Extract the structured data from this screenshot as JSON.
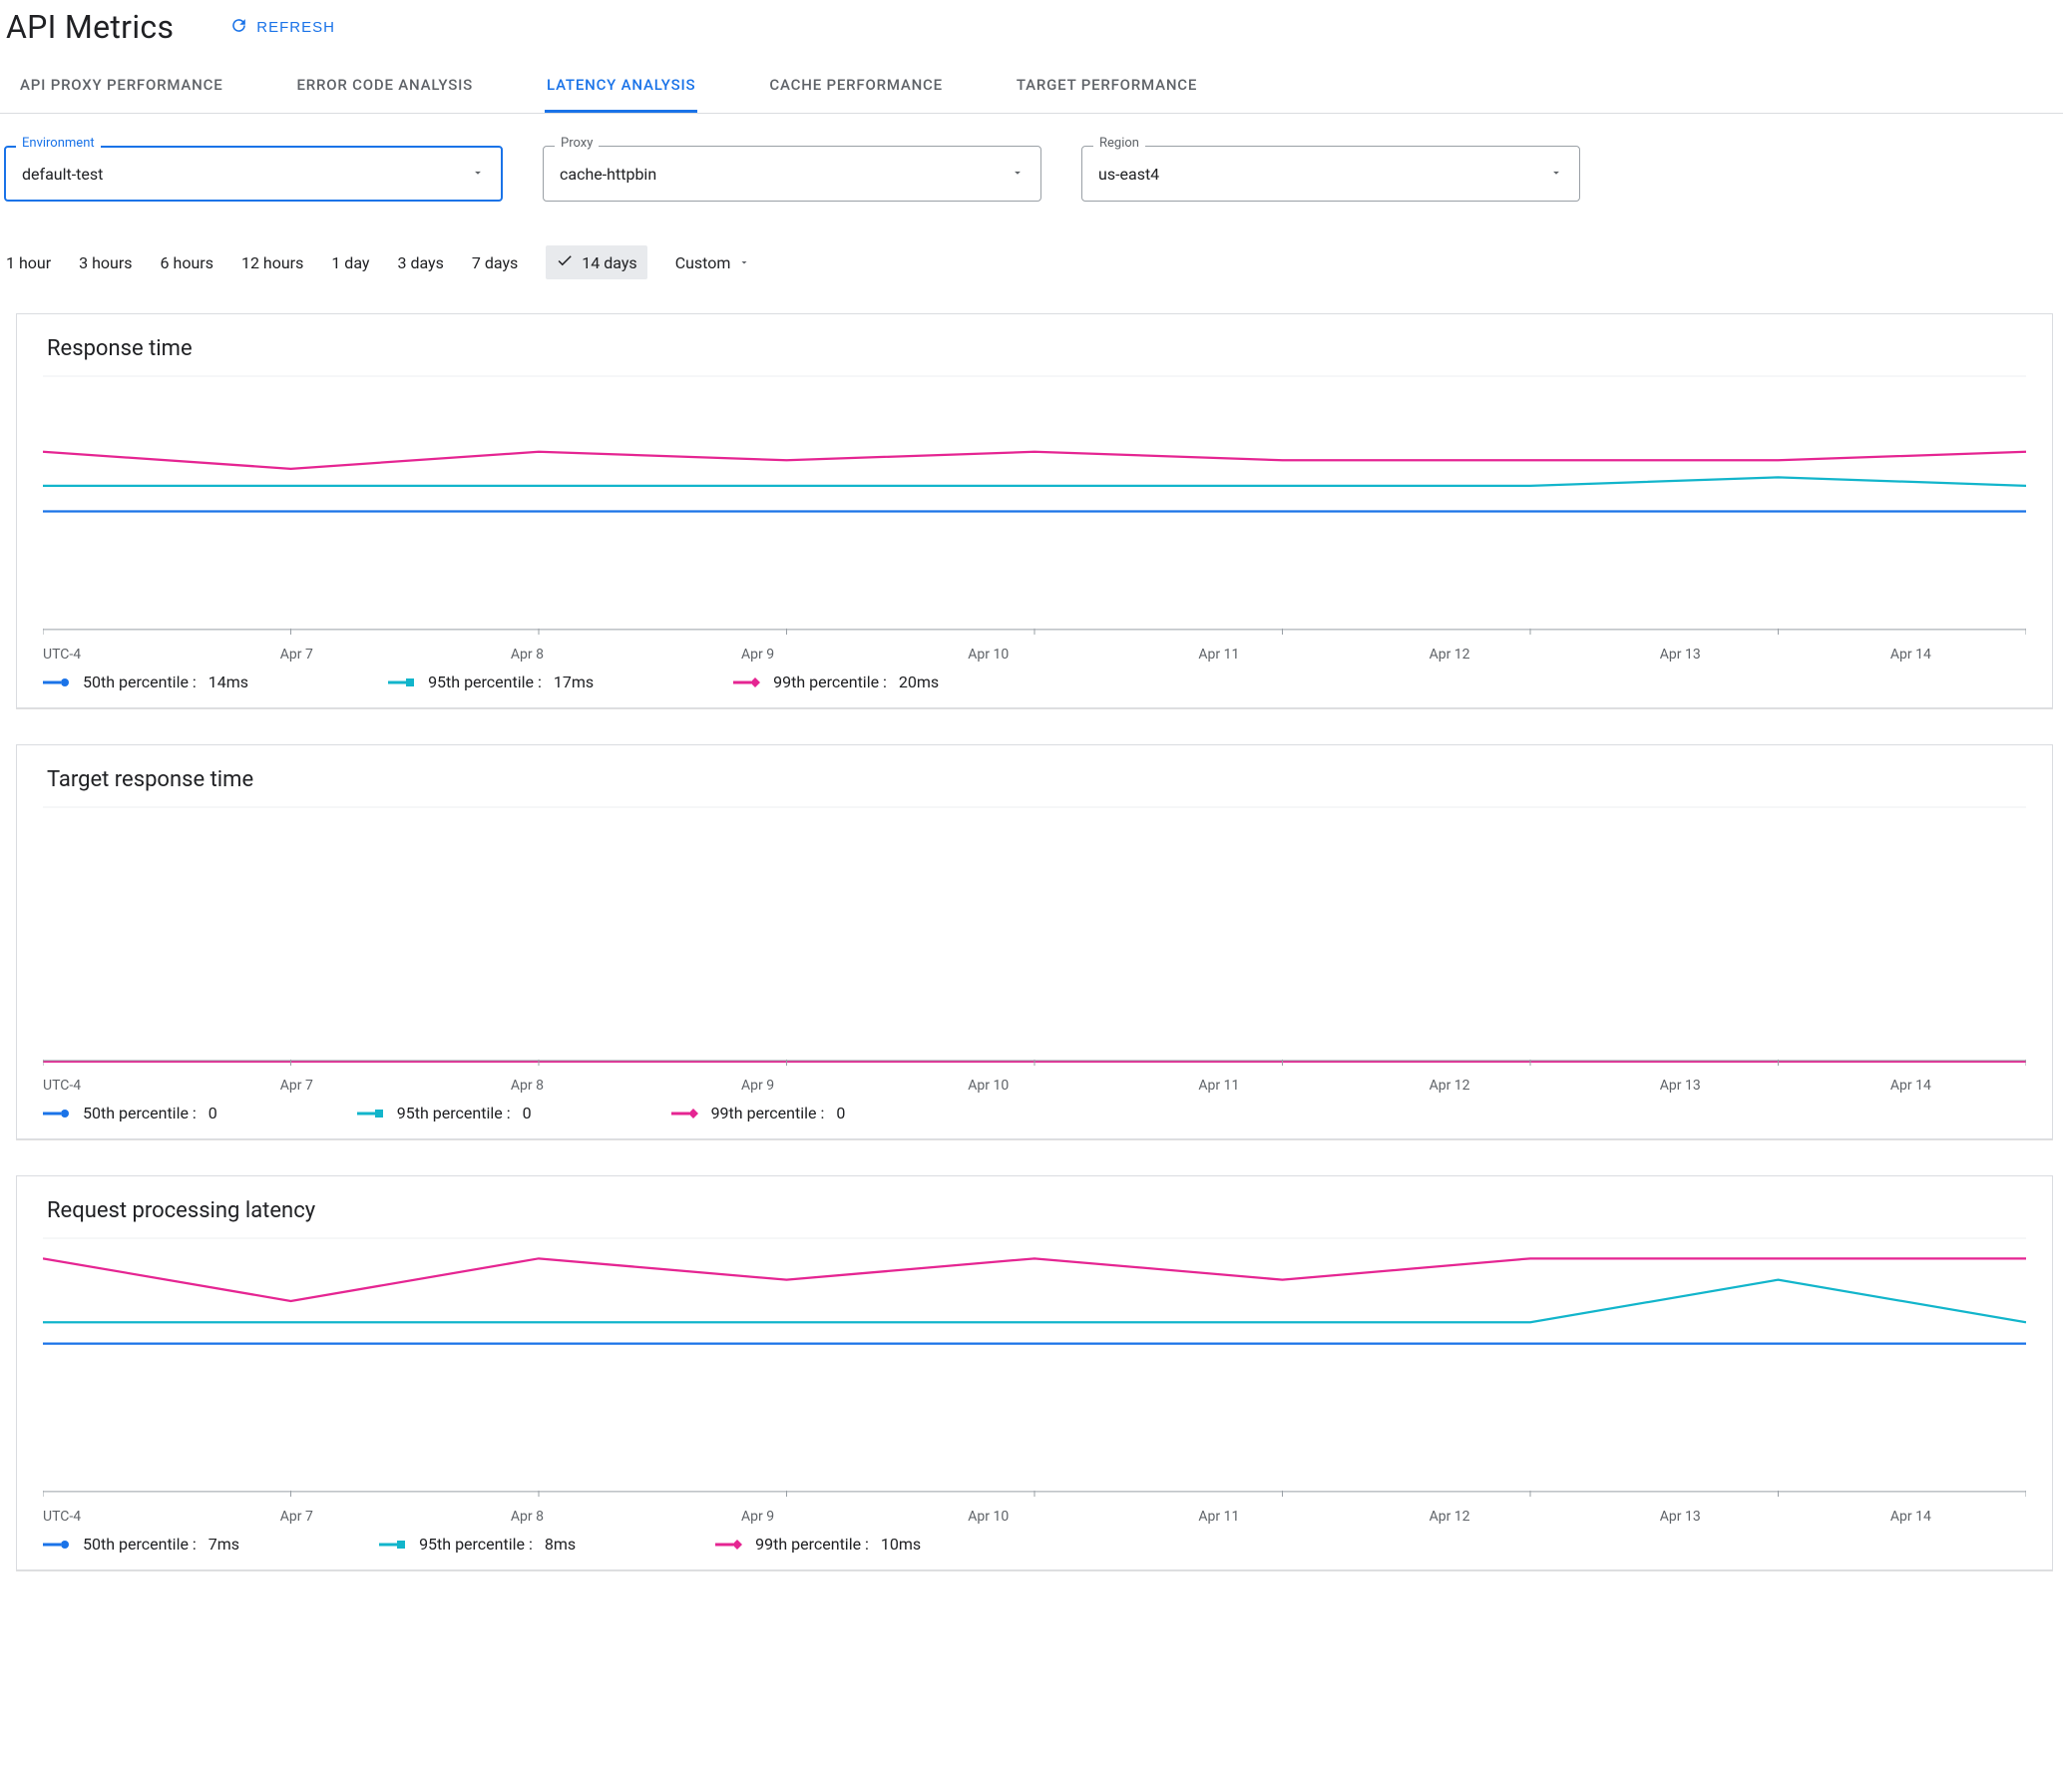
{
  "header": {
    "title": "API Metrics",
    "refresh": "REFRESH"
  },
  "tabs": [
    {
      "id": "api-proxy-performance",
      "label": "API PROXY PERFORMANCE",
      "active": false
    },
    {
      "id": "error-code-analysis",
      "label": "ERROR CODE ANALYSIS",
      "active": false
    },
    {
      "id": "latency-analysis",
      "label": "LATENCY ANALYSIS",
      "active": true
    },
    {
      "id": "cache-performance",
      "label": "CACHE PERFORMANCE",
      "active": false
    },
    {
      "id": "target-performance",
      "label": "TARGET PERFORMANCE",
      "active": false
    }
  ],
  "filters": {
    "environment": {
      "label": "Environment",
      "value": "default-test",
      "focused": true
    },
    "proxy": {
      "label": "Proxy",
      "value": "cache-httpbin",
      "focused": false
    },
    "region": {
      "label": "Region",
      "value": "us-east4",
      "focused": false
    }
  },
  "timerange": {
    "options": [
      "1 hour",
      "3 hours",
      "6 hours",
      "12 hours",
      "1 day",
      "3 days",
      "7 days",
      "14 days"
    ],
    "selected": "14 days",
    "custom_label": "Custom"
  },
  "x_ticks": [
    "UTC-4",
    "Apr 7",
    "Apr 8",
    "Apr 9",
    "Apr 10",
    "Apr 11",
    "Apr 12",
    "Apr 13",
    "Apr 14"
  ],
  "legend_series": [
    {
      "name": "50th percentile",
      "color": "#1a73e8",
      "marker": "circle"
    },
    {
      "name": "95th percentile",
      "color": "#12b5cb",
      "marker": "square"
    },
    {
      "name": "99th percentile",
      "color": "#e52592",
      "marker": "diamond"
    }
  ],
  "charts": [
    {
      "id": "response-time",
      "title": "Response time",
      "ylim": [
        0,
        30
      ],
      "legend_values": [
        "14ms",
        "17ms",
        "20ms"
      ]
    },
    {
      "id": "target-response-time",
      "title": "Target response time",
      "ylim": [
        0,
        30
      ],
      "legend_values": [
        "0",
        "0",
        "0"
      ]
    },
    {
      "id": "request-processing-latency",
      "title": "Request processing latency",
      "ylim": [
        0,
        12
      ],
      "legend_values": [
        "7ms",
        "8ms",
        "10ms"
      ]
    }
  ],
  "chart_data": [
    {
      "id": "response-time",
      "type": "line",
      "title": "Response time",
      "xlabel": "",
      "ylabel": "",
      "ylim": [
        0,
        30
      ],
      "categories": [
        "UTC-4",
        "Apr 7",
        "Apr 8",
        "Apr 9",
        "Apr 10",
        "Apr 11",
        "Apr 12",
        "Apr 13",
        "Apr 14"
      ],
      "series": [
        {
          "name": "50th percentile",
          "color": "#1a73e8",
          "values": [
            14,
            14,
            14,
            14,
            14,
            14,
            14,
            14,
            14
          ]
        },
        {
          "name": "95th percentile",
          "color": "#12b5cb",
          "values": [
            17,
            17,
            17,
            17,
            17,
            17,
            17,
            18,
            17
          ]
        },
        {
          "name": "99th percentile",
          "color": "#e52592",
          "values": [
            21,
            19,
            21,
            20,
            21,
            20,
            20,
            20,
            21
          ]
        }
      ]
    },
    {
      "id": "target-response-time",
      "type": "line",
      "title": "Target response time",
      "xlabel": "",
      "ylabel": "",
      "ylim": [
        0,
        30
      ],
      "categories": [
        "UTC-4",
        "Apr 7",
        "Apr 8",
        "Apr 9",
        "Apr 10",
        "Apr 11",
        "Apr 12",
        "Apr 13",
        "Apr 14"
      ],
      "series": [
        {
          "name": "50th percentile",
          "color": "#1a73e8",
          "values": [
            0,
            0,
            0,
            0,
            0,
            0,
            0,
            0,
            0
          ]
        },
        {
          "name": "95th percentile",
          "color": "#12b5cb",
          "values": [
            0,
            0,
            0,
            0,
            0,
            0,
            0,
            0,
            0
          ]
        },
        {
          "name": "99th percentile",
          "color": "#e52592",
          "values": [
            0,
            0,
            0,
            0,
            0,
            0,
            0,
            0,
            0
          ]
        }
      ]
    },
    {
      "id": "request-processing-latency",
      "type": "line",
      "title": "Request processing latency",
      "xlabel": "",
      "ylabel": "",
      "ylim": [
        0,
        12
      ],
      "categories": [
        "UTC-4",
        "Apr 7",
        "Apr 8",
        "Apr 9",
        "Apr 10",
        "Apr 11",
        "Apr 12",
        "Apr 13",
        "Apr 14"
      ],
      "series": [
        {
          "name": "50th percentile",
          "color": "#1a73e8",
          "values": [
            7,
            7,
            7,
            7,
            7,
            7,
            7,
            7,
            7
          ]
        },
        {
          "name": "95th percentile",
          "color": "#12b5cb",
          "values": [
            8,
            8,
            8,
            8,
            8,
            8,
            8,
            10,
            8
          ]
        },
        {
          "name": "99th percentile",
          "color": "#e52592",
          "values": [
            11,
            9,
            11,
            10,
            11,
            10,
            11,
            11,
            11
          ]
        }
      ]
    }
  ]
}
